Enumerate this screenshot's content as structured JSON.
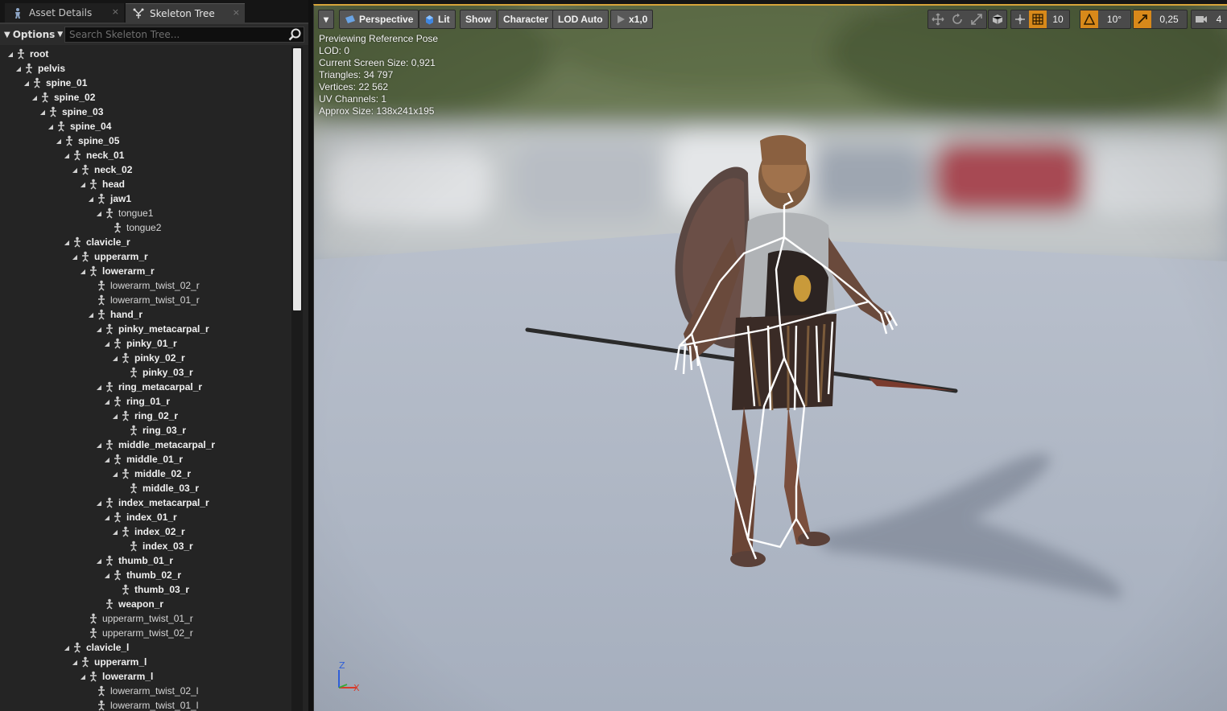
{
  "tabs": [
    {
      "label": "Asset Details",
      "icon": "asset-details-icon",
      "close": "×"
    },
    {
      "label": "Skeleton Tree",
      "icon": "skeleton-icon",
      "close": "×"
    }
  ],
  "toolbar": {
    "options_label": "Options",
    "search_placeholder": "Search Skeleton Tree..."
  },
  "tree": [
    {
      "label": "root",
      "depth": 0,
      "expanded": true,
      "bold": true
    },
    {
      "label": "pelvis",
      "depth": 1,
      "expanded": true,
      "bold": true
    },
    {
      "label": "spine_01",
      "depth": 2,
      "expanded": true,
      "bold": true
    },
    {
      "label": "spine_02",
      "depth": 3,
      "expanded": true,
      "bold": true
    },
    {
      "label": "spine_03",
      "depth": 4,
      "expanded": true,
      "bold": true
    },
    {
      "label": "spine_04",
      "depth": 5,
      "expanded": true,
      "bold": true
    },
    {
      "label": "spine_05",
      "depth": 6,
      "expanded": true,
      "bold": true
    },
    {
      "label": "neck_01",
      "depth": 7,
      "expanded": true,
      "bold": true
    },
    {
      "label": "neck_02",
      "depth": 8,
      "expanded": true,
      "bold": true
    },
    {
      "label": "head",
      "depth": 9,
      "expanded": true,
      "bold": true
    },
    {
      "label": "jaw1",
      "depth": 10,
      "expanded": true,
      "bold": true
    },
    {
      "label": "tongue1",
      "depth": 11,
      "expanded": true,
      "bold": false
    },
    {
      "label": "tongue2",
      "depth": 12,
      "expanded": null,
      "bold": false
    },
    {
      "label": "clavicle_r",
      "depth": 7,
      "expanded": true,
      "bold": true
    },
    {
      "label": "upperarm_r",
      "depth": 8,
      "expanded": true,
      "bold": true
    },
    {
      "label": "lowerarm_r",
      "depth": 9,
      "expanded": true,
      "bold": true
    },
    {
      "label": "lowerarm_twist_02_r",
      "depth": 10,
      "expanded": null,
      "bold": false
    },
    {
      "label": "lowerarm_twist_01_r",
      "depth": 10,
      "expanded": null,
      "bold": false
    },
    {
      "label": "hand_r",
      "depth": 10,
      "expanded": true,
      "bold": true
    },
    {
      "label": "pinky_metacarpal_r",
      "depth": 11,
      "expanded": true,
      "bold": true
    },
    {
      "label": "pinky_01_r",
      "depth": 12,
      "expanded": true,
      "bold": true
    },
    {
      "label": "pinky_02_r",
      "depth": 13,
      "expanded": true,
      "bold": true
    },
    {
      "label": "pinky_03_r",
      "depth": 14,
      "expanded": null,
      "bold": true
    },
    {
      "label": "ring_metacarpal_r",
      "depth": 11,
      "expanded": true,
      "bold": true
    },
    {
      "label": "ring_01_r",
      "depth": 12,
      "expanded": true,
      "bold": true
    },
    {
      "label": "ring_02_r",
      "depth": 13,
      "expanded": true,
      "bold": true
    },
    {
      "label": "ring_03_r",
      "depth": 14,
      "expanded": null,
      "bold": true
    },
    {
      "label": "middle_metacarpal_r",
      "depth": 11,
      "expanded": true,
      "bold": true
    },
    {
      "label": "middle_01_r",
      "depth": 12,
      "expanded": true,
      "bold": true
    },
    {
      "label": "middle_02_r",
      "depth": 13,
      "expanded": true,
      "bold": true
    },
    {
      "label": "middle_03_r",
      "depth": 14,
      "expanded": null,
      "bold": true
    },
    {
      "label": "index_metacarpal_r",
      "depth": 11,
      "expanded": true,
      "bold": true
    },
    {
      "label": "index_01_r",
      "depth": 12,
      "expanded": true,
      "bold": true
    },
    {
      "label": "index_02_r",
      "depth": 13,
      "expanded": true,
      "bold": true
    },
    {
      "label": "index_03_r",
      "depth": 14,
      "expanded": null,
      "bold": true
    },
    {
      "label": "thumb_01_r",
      "depth": 11,
      "expanded": true,
      "bold": true
    },
    {
      "label": "thumb_02_r",
      "depth": 12,
      "expanded": true,
      "bold": true
    },
    {
      "label": "thumb_03_r",
      "depth": 13,
      "expanded": null,
      "bold": true
    },
    {
      "label": "weapon_r",
      "depth": 11,
      "expanded": null,
      "bold": true
    },
    {
      "label": "upperarm_twist_01_r",
      "depth": 9,
      "expanded": null,
      "bold": false
    },
    {
      "label": "upperarm_twist_02_r",
      "depth": 9,
      "expanded": null,
      "bold": false
    },
    {
      "label": "clavicle_l",
      "depth": 7,
      "expanded": true,
      "bold": true
    },
    {
      "label": "upperarm_l",
      "depth": 8,
      "expanded": true,
      "bold": true
    },
    {
      "label": "lowerarm_l",
      "depth": 9,
      "expanded": true,
      "bold": true
    },
    {
      "label": "lowerarm_twist_02_l",
      "depth": 10,
      "expanded": null,
      "bold": false
    },
    {
      "label": "lowerarm_twist_01_l",
      "depth": 10,
      "expanded": null,
      "bold": false
    }
  ],
  "viewport": {
    "buttons": {
      "menu": "▾",
      "perspective": "Perspective",
      "lit": "Lit",
      "show": "Show",
      "character": "Character",
      "lod": "LOD Auto",
      "speed": "x1,0"
    },
    "stats": [
      "Previewing Reference Pose",
      "LOD: 0",
      "Current Screen Size: 0,921",
      "Triangles: 34 797",
      "Vertices: 22 562",
      "UV Channels: 1",
      "Approx Size: 138x241x195"
    ],
    "right_toolbar": {
      "grid_snap": "10",
      "rotation_snap": "10°",
      "scale_snap": "0,25",
      "camera_speed": "4"
    },
    "axis": {
      "z": "Z",
      "x": "X"
    }
  },
  "colors": {
    "accent_orange": "#d8891a",
    "viewport_border": "#d7a53a",
    "panel_bg": "#242424"
  }
}
